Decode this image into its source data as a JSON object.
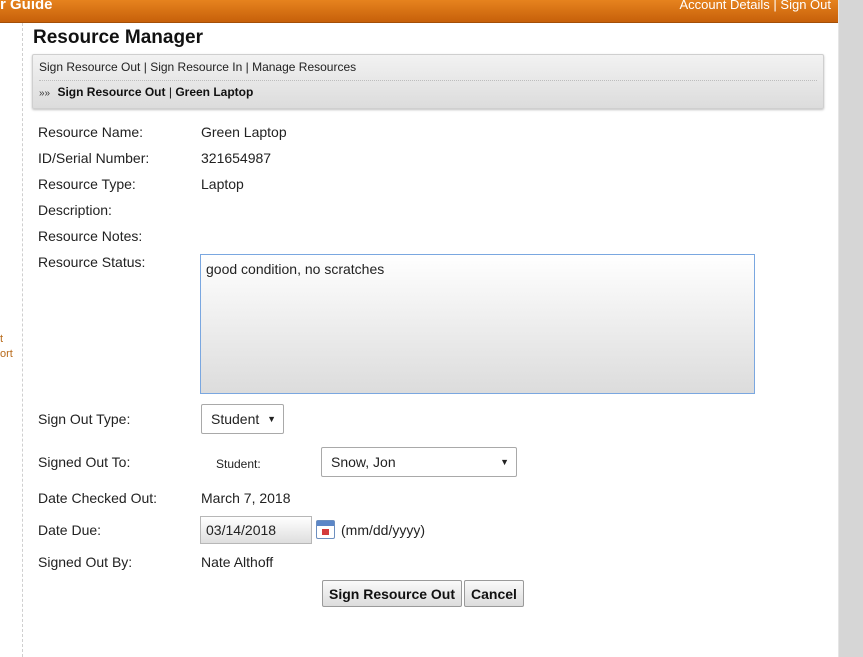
{
  "header": {
    "brand": "r Guide",
    "account_link": "Account Details",
    "separator": "|",
    "signout_link": "Sign Out"
  },
  "left_fragments": [
    "t",
    "ort"
  ],
  "page_title": "Resource Manager",
  "nav": {
    "links": [
      "Sign Resource Out",
      "Sign Resource In",
      "Manage Resources"
    ],
    "separator": "|",
    "breadcrumb_arrows": "»»",
    "breadcrumb": [
      "Sign Resource Out",
      "Green Laptop"
    ]
  },
  "fields": {
    "resource_name": {
      "label": "Resource Name:",
      "value": "Green Laptop"
    },
    "serial": {
      "label": "ID/Serial Number:",
      "value": "321654987"
    },
    "type": {
      "label": "Resource Type:",
      "value": "Laptop"
    },
    "description": {
      "label": "Description:",
      "value": ""
    },
    "notes": {
      "label": "Resource Notes:",
      "value": ""
    },
    "status": {
      "label": "Resource Status:",
      "value": "good condition, no scratches"
    },
    "signout_type": {
      "label": "Sign Out Type:",
      "value": "Student"
    },
    "signed_to": {
      "label": "Signed Out To:",
      "sub_label": "Student:",
      "value": "Snow, Jon"
    },
    "date_checked": {
      "label": "Date Checked Out:",
      "value": "March 7, 2018"
    },
    "date_due": {
      "label": "Date Due:",
      "value": "03/14/2018",
      "hint": "(mm/dd/yyyy)"
    },
    "signed_by": {
      "label": "Signed Out By:",
      "value": "Nate Althoff"
    }
  },
  "buttons": {
    "submit": "Sign Resource Out",
    "cancel": "Cancel"
  },
  "icons": {
    "calendar": "calendar-icon",
    "dropdown": "chevron-down-icon"
  },
  "colors": {
    "header": "#d56f12",
    "link_fragment": "#b86a1a",
    "focus_border": "#7aa7e0"
  }
}
